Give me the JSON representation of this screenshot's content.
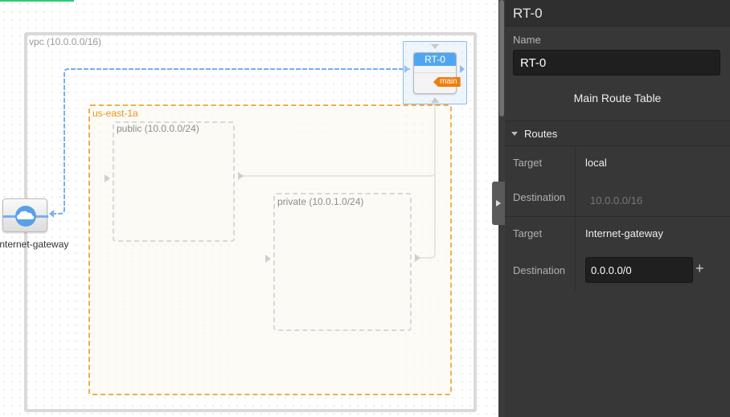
{
  "canvas": {
    "vpc": {
      "label": "vpc (10.0.0.0/16)"
    },
    "availability_zone": {
      "label": "us-east-1a"
    },
    "subnets": [
      {
        "label": "public (10.0.0.0/24)"
      },
      {
        "label": "private (10.0.1.0/24)"
      }
    ],
    "route_table_node": {
      "title": "RT-0",
      "badge": "main"
    },
    "internet_gateway": {
      "label": "Internet-gateway",
      "icon": "cloud-icon"
    },
    "colors": {
      "vpc_border": "#d9d9d9",
      "az_border": "#f0ad4e",
      "connection_blue": "#7aaef0",
      "connection_gray": "#c8c8c8",
      "badge_orange": "#f07d0f"
    }
  },
  "panel": {
    "title": "RT-0",
    "name_label": "Name",
    "name_value": "RT-0",
    "main_route_table_label": "Main Route Table",
    "routes_section": {
      "title": "Routes",
      "routes": [
        {
          "target_label": "Target",
          "target": "local",
          "destination_label": "Destination",
          "destination": "10.0.0.0/16"
        },
        {
          "target_label": "Target",
          "target": "Internet-gateway",
          "destination_label": "Destination",
          "destination": "0.0.0.0/0",
          "add_icon": "+"
        }
      ]
    }
  }
}
